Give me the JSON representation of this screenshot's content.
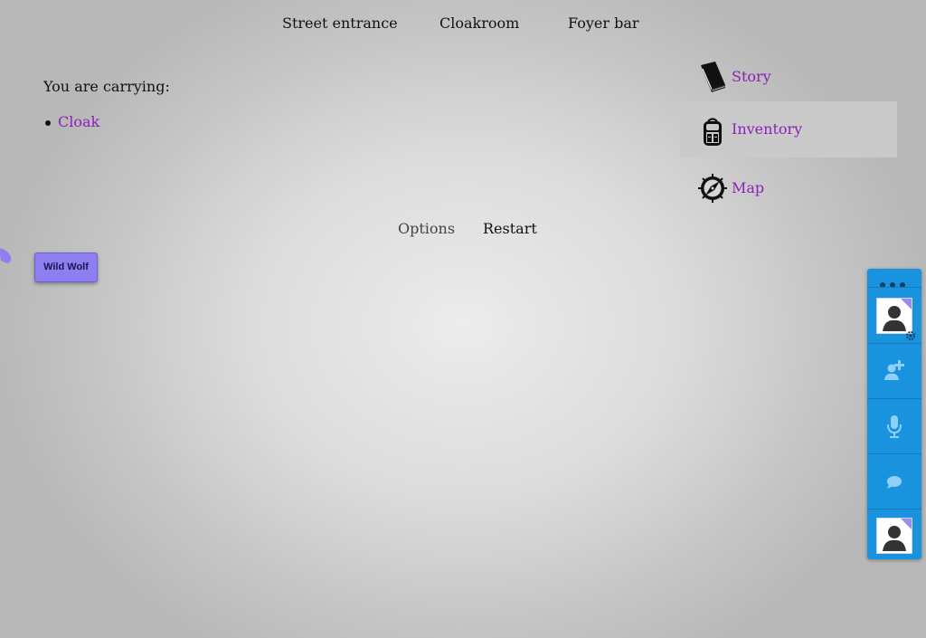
{
  "topnav": {
    "street_entrance": "Street entrance",
    "cloakroom": "Cloakroom",
    "foyer_bar": "Foyer bar"
  },
  "inventory": {
    "title": "You are carrying:",
    "items": [
      {
        "label": "Cloak"
      }
    ]
  },
  "sidebar": {
    "items": [
      {
        "label": "Story",
        "icon": "book-icon"
      },
      {
        "label": "Inventory",
        "icon": "backpack-icon",
        "active": true
      },
      {
        "label": "Map",
        "icon": "compass-icon"
      }
    ]
  },
  "footer_links": {
    "options": "Options",
    "restart": "Restart"
  },
  "badge": {
    "label": "Wild Wolf",
    "color": "#8d7ff0"
  },
  "chat_widget": {
    "color": "#1a93df",
    "buttons": [
      "menu-dots-icon",
      "avatar-icon",
      "add-user-icon",
      "microphone-icon",
      "chat-bubble-icon",
      "avatar-icon"
    ]
  },
  "colors": {
    "link": "#8c1fb8",
    "active_bg": "#cacaca"
  }
}
